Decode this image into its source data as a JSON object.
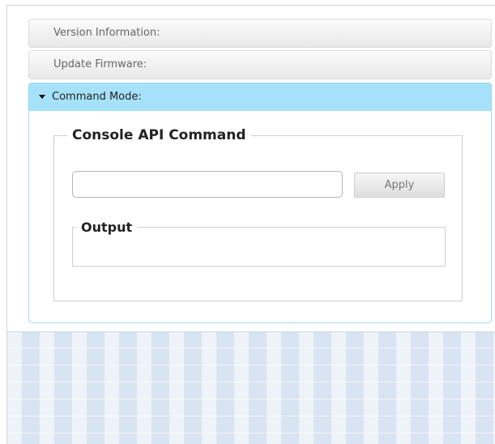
{
  "accordion": {
    "sections": [
      {
        "label": "Version Information:"
      },
      {
        "label": "Update Firmware:"
      },
      {
        "label": "Command Mode:"
      }
    ]
  },
  "command_mode": {
    "console_legend": "Console API Command",
    "input": {
      "value": "",
      "placeholder": ""
    },
    "apply_label": "Apply",
    "output_legend": "Output",
    "output_value": ""
  },
  "colors": {
    "active_header": "#a6e1fa",
    "background_pattern": "#d9e4f2"
  }
}
